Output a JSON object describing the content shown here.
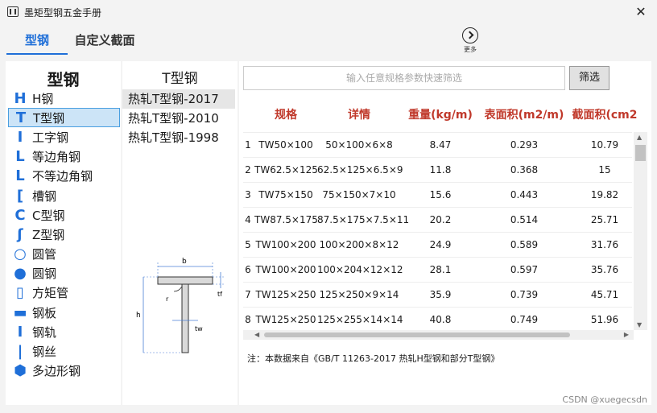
{
  "window": {
    "title": "墨矩型钢五金手册",
    "close_glyph": "✕"
  },
  "tabs": [
    {
      "label": "型钢"
    },
    {
      "label": "自定义截面"
    }
  ],
  "more": {
    "label": "更多"
  },
  "categories": {
    "heading": "型钢",
    "items": [
      {
        "label": "H钢",
        "icon": "h-beam-icon"
      },
      {
        "label": "T型钢",
        "icon": "t-beam-icon"
      },
      {
        "label": "工字钢",
        "icon": "i-beam-icon"
      },
      {
        "label": "等边角钢",
        "icon": "angle-icon"
      },
      {
        "label": "不等边角钢",
        "icon": "unequal-angle-icon"
      },
      {
        "label": "槽钢",
        "icon": "channel-icon"
      },
      {
        "label": "C型钢",
        "icon": "c-section-icon"
      },
      {
        "label": "Z型钢",
        "icon": "z-section-icon"
      },
      {
        "label": "圆管",
        "icon": "round-tube-icon"
      },
      {
        "label": "圆钢",
        "icon": "round-bar-icon"
      },
      {
        "label": "方矩管",
        "icon": "rect-tube-icon"
      },
      {
        "label": "钢板",
        "icon": "plate-icon"
      },
      {
        "label": "钢轨",
        "icon": "rail-icon"
      },
      {
        "label": "钢丝",
        "icon": "wire-icon"
      },
      {
        "label": "多边形钢",
        "icon": "polygon-icon"
      }
    ]
  },
  "standards": {
    "heading": "T型钢",
    "items": [
      {
        "label": "热轧T型钢-2017"
      },
      {
        "label": "热轧T型钢-2010"
      },
      {
        "label": "热轧T型钢-1998"
      }
    ],
    "diagram_labels": {
      "b": "b",
      "h": "h",
      "r": "r",
      "tf": "tf",
      "tw": "tw"
    }
  },
  "search": {
    "placeholder": "输入任意规格参数快速筛选",
    "filter_label": "筛选"
  },
  "table": {
    "headers": [
      "规格",
      "详情",
      "重量(kg/m)",
      "表面积(m2/m)",
      "截面积(cm2"
    ],
    "rows": [
      {
        "num": "1",
        "cells": [
          "TW50×100",
          "50×100×6×8",
          "8.47",
          "0.293",
          "10.79"
        ]
      },
      {
        "num": "2",
        "cells": [
          "TW62.5×125",
          "62.5×125×6.5×9",
          "11.8",
          "0.368",
          "15"
        ]
      },
      {
        "num": "3",
        "cells": [
          "TW75×150",
          "75×150×7×10",
          "15.6",
          "0.443",
          "19.82"
        ]
      },
      {
        "num": "4",
        "cells": [
          "TW87.5×175",
          "87.5×175×7.5×11",
          "20.2",
          "0.514",
          "25.71"
        ]
      },
      {
        "num": "5",
        "cells": [
          "TW100×200",
          "100×200×8×12",
          "24.9",
          "0.589",
          "31.76"
        ]
      },
      {
        "num": "6",
        "cells": [
          "TW100×200",
          "100×204×12×12",
          "28.1",
          "0.597",
          "35.76"
        ]
      },
      {
        "num": "7",
        "cells": [
          "TW125×250",
          "125×250×9×14",
          "35.9",
          "0.739",
          "45.71"
        ]
      },
      {
        "num": "8",
        "cells": [
          "TW125×250",
          "125×255×14×14",
          "40.8",
          "0.749",
          "51.96"
        ]
      }
    ]
  },
  "note": "注：本数据来自《GB/T 11263-2017 热轧H型钢和部分T型钢》",
  "watermark": "CSDN @xuegecsdn"
}
